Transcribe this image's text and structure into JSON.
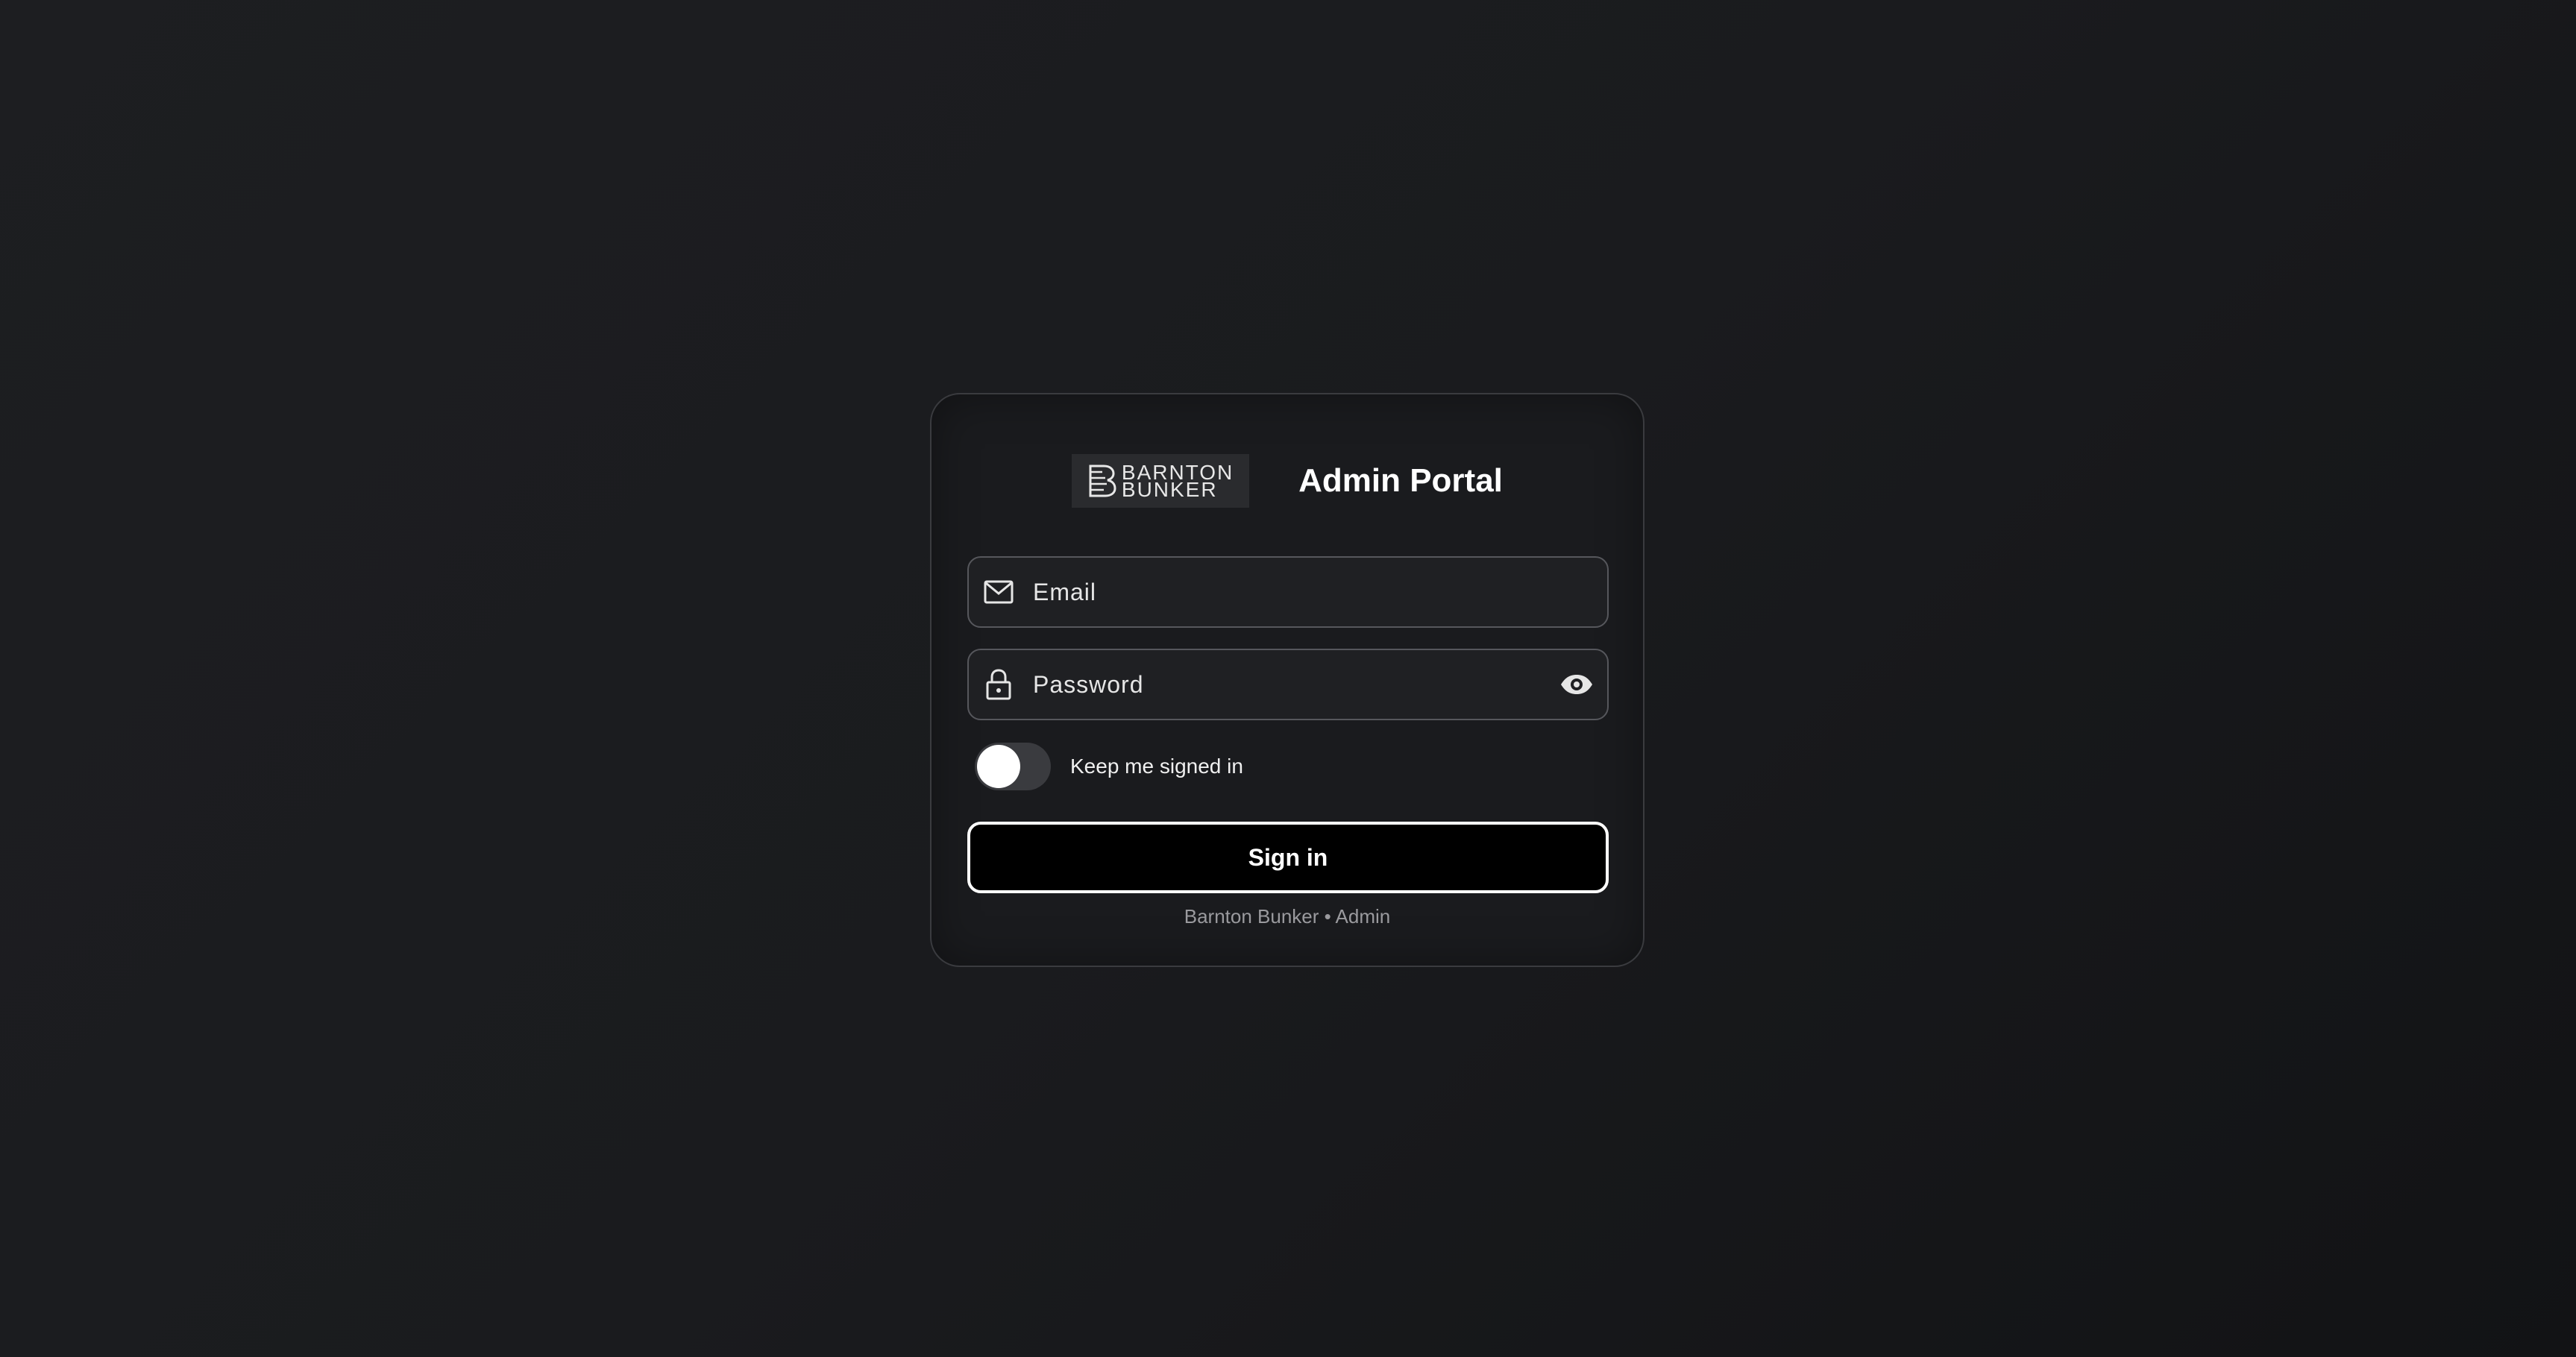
{
  "brand": {
    "logo_line1": "BARNTON",
    "logo_line2": "BUNKER"
  },
  "header": {
    "title": "Admin Portal"
  },
  "form": {
    "email": {
      "placeholder": "Email",
      "value": "",
      "icon": "mail-icon"
    },
    "password": {
      "placeholder": "Password",
      "value": "",
      "icon": "lock-icon",
      "toggle_icon": "eye-icon"
    },
    "keep_signed_in": {
      "label": "Keep me signed in",
      "checked": false
    },
    "submit_label": "Sign in"
  },
  "footer": {
    "text": "Barnton Bunker • Admin"
  },
  "colors": {
    "background": "#1a1b1e",
    "card_border": "#3a3b3f",
    "field_border": "#56575c",
    "button_bg": "#000000",
    "button_border": "#ffffff",
    "footer_text": "#9a9a9e"
  }
}
